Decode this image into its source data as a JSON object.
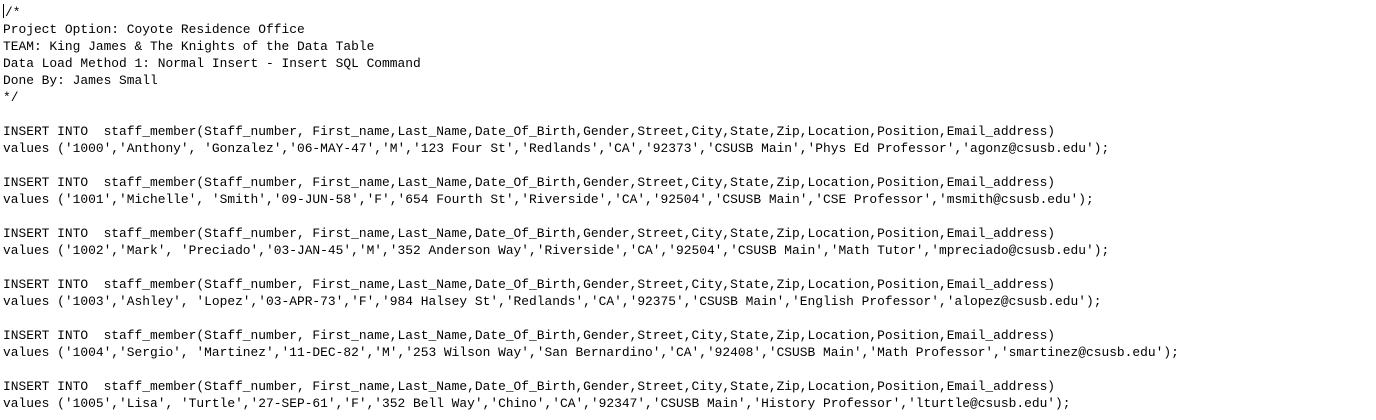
{
  "header_comment": {
    "open": "/*",
    "project": "Project Option: Coyote Residence Office",
    "team": "TEAM: King James & The Knights of the Data Table",
    "method": "Data Load Method 1: Normal Insert - Insert SQL Command",
    "author": "Done By: James Small",
    "close": "*/"
  },
  "statements": [
    {
      "insert": "INSERT INTO  staff_member(Staff_number, First_name,Last_Name,Date_Of_Birth,Gender,Street,City,State,Zip,Location,Position,Email_address)",
      "values": "values ('1000','Anthony', 'Gonzalez','06-MAY-47','M','123 Four St','Redlands','CA','92373','CSUSB Main','Phys Ed Professor','agonz@csusb.edu');"
    },
    {
      "insert": "INSERT INTO  staff_member(Staff_number, First_name,Last_Name,Date_Of_Birth,Gender,Street,City,State,Zip,Location,Position,Email_address)",
      "values": "values ('1001','Michelle', 'Smith','09-JUN-58','F','654 Fourth St','Riverside','CA','92504','CSUSB Main','CSE Professor','msmith@csusb.edu');"
    },
    {
      "insert": "INSERT INTO  staff_member(Staff_number, First_name,Last_Name,Date_Of_Birth,Gender,Street,City,State,Zip,Location,Position,Email_address)",
      "values": "values ('1002','Mark', 'Preciado','03-JAN-45','M','352 Anderson Way','Riverside','CA','92504','CSUSB Main','Math Tutor','mpreciado@csusb.edu');"
    },
    {
      "insert": "INSERT INTO  staff_member(Staff_number, First_name,Last_Name,Date_Of_Birth,Gender,Street,City,State,Zip,Location,Position,Email_address)",
      "values": "values ('1003','Ashley', 'Lopez','03-APR-73','F','984 Halsey St','Redlands','CA','92375','CSUSB Main','English Professor','alopez@csusb.edu');"
    },
    {
      "insert": "INSERT INTO  staff_member(Staff_number, First_name,Last_Name,Date_Of_Birth,Gender,Street,City,State,Zip,Location,Position,Email_address)",
      "values": "values ('1004','Sergio', 'Martinez','11-DEC-82','M','253 Wilson Way','San Bernardino','CA','92408','CSUSB Main','Math Professor','smartinez@csusb.edu');"
    },
    {
      "insert": "INSERT INTO  staff_member(Staff_number, First_name,Last_Name,Date_Of_Birth,Gender,Street,City,State,Zip,Location,Position,Email_address)",
      "values": "values ('1005','Lisa', 'Turtle','27-SEP-61','F','352 Bell Way','Chino','CA','92347','CSUSB Main','History Professor','lturtle@csusb.edu');"
    }
  ]
}
